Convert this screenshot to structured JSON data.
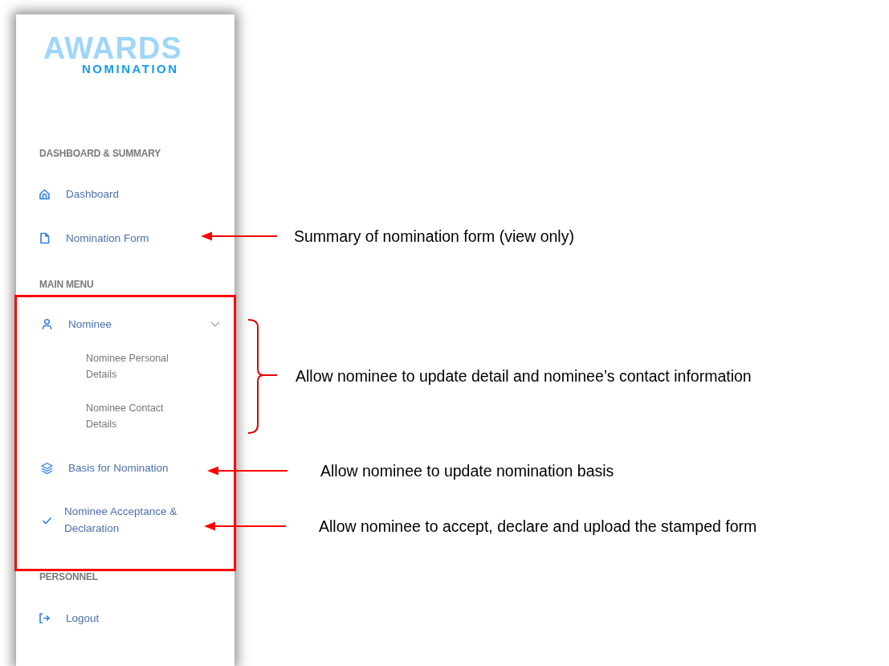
{
  "logo": {
    "wordmark": "AWARDS",
    "tagline": "NOMINATION"
  },
  "sidebar": {
    "sections": [
      {
        "heading": "DASHBOARD & SUMMARY",
        "highlighted": false,
        "items": [
          {
            "label": "Dashboard"
          },
          {
            "label": "Nomination Form"
          }
        ]
      },
      {
        "heading": "MAIN MENU",
        "highlighted": true,
        "items": [
          {
            "label": "Nominee",
            "expanded": true,
            "children": [
              {
                "label": "Nominee Personal Details"
              },
              {
                "label": "Nominee Contact Details"
              }
            ]
          },
          {
            "label": "Basis for Nomination"
          },
          {
            "label": "Nominee Acceptance & Declaration"
          }
        ]
      },
      {
        "heading": "PERSONNEL",
        "highlighted": false,
        "items": [
          {
            "label": "Logout"
          }
        ]
      }
    ]
  },
  "annotations": [
    {
      "kind": "arrow",
      "text": "Summary of nomination form (view only)"
    },
    {
      "kind": "bracket",
      "text": "Allow nominee to update detail and nominee’s contact information"
    },
    {
      "kind": "arrow",
      "text": "Allow nominee to update nomination basis"
    },
    {
      "kind": "arrow",
      "text": "Allow nominee to accept, declare and upload the stamped form"
    }
  ]
}
